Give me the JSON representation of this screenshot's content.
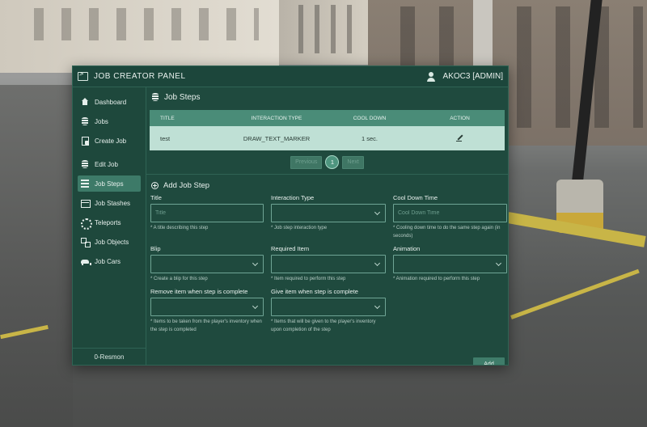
{
  "panel": {
    "title": "JOB CREATOR PANEL",
    "user": "AKOC3 [ADMIN]"
  },
  "sidebar": {
    "items": [
      {
        "label": "Dashboard",
        "icon": "home-icon"
      },
      {
        "label": "Jobs",
        "icon": "database-icon"
      },
      {
        "label": "Create Job",
        "icon": "file-edit-icon"
      },
      {
        "label": "Edit Job",
        "icon": "database-edit-icon"
      },
      {
        "label": "Job Steps",
        "icon": "list-icon",
        "active": true
      },
      {
        "label": "Job Stashes",
        "icon": "box-icon"
      },
      {
        "label": "Teleports",
        "icon": "teleport-icon"
      },
      {
        "label": "Job Objects",
        "icon": "objects-icon"
      },
      {
        "label": "Job Cars",
        "icon": "car-icon"
      }
    ],
    "footer": "0-Resmon"
  },
  "steps": {
    "heading": "Job Steps",
    "columns": [
      "TITLE",
      "INTERACTION TYPE",
      "COOL DOWN",
      "ACTION"
    ],
    "rows": [
      {
        "title": "test",
        "interaction_type": "DRAW_TEXT_MARKER",
        "cool_down": "1 sec."
      }
    ],
    "pager": {
      "previous": "Previous",
      "current": "1",
      "next": "Next"
    }
  },
  "form": {
    "heading": "Add Job Step",
    "title": {
      "label": "Title",
      "placeholder": "Title",
      "help": "* A title describing this step"
    },
    "interaction_type": {
      "label": "Interaction Type",
      "help": "* Job step interaction type"
    },
    "cool_down": {
      "label": "Cool Down Time",
      "placeholder": "Cool Down Time",
      "help": "* Cooling down time to do the same step again (in seconds)"
    },
    "blip": {
      "label": "Blip",
      "help": "* Create a blip for this step"
    },
    "required_item": {
      "label": "Required Item",
      "help": "* Item required to perform this step"
    },
    "animation": {
      "label": "Animation",
      "help": "* Animation required to perform this step"
    },
    "remove_item": {
      "label": "Remove item when step is complete",
      "help": "* Items to be taken from the player's inventory when the step is completed"
    },
    "give_item": {
      "label": "Give item when step is complete",
      "help": "* Items that will be given to the player's inventory upon completion of the step"
    },
    "add_label": "Add"
  },
  "colors": {
    "panel_bg": "#1f4a3e",
    "header_row": "#4a8c78",
    "data_row": "#bfe0d5",
    "active_nav": "#3d7a68"
  }
}
